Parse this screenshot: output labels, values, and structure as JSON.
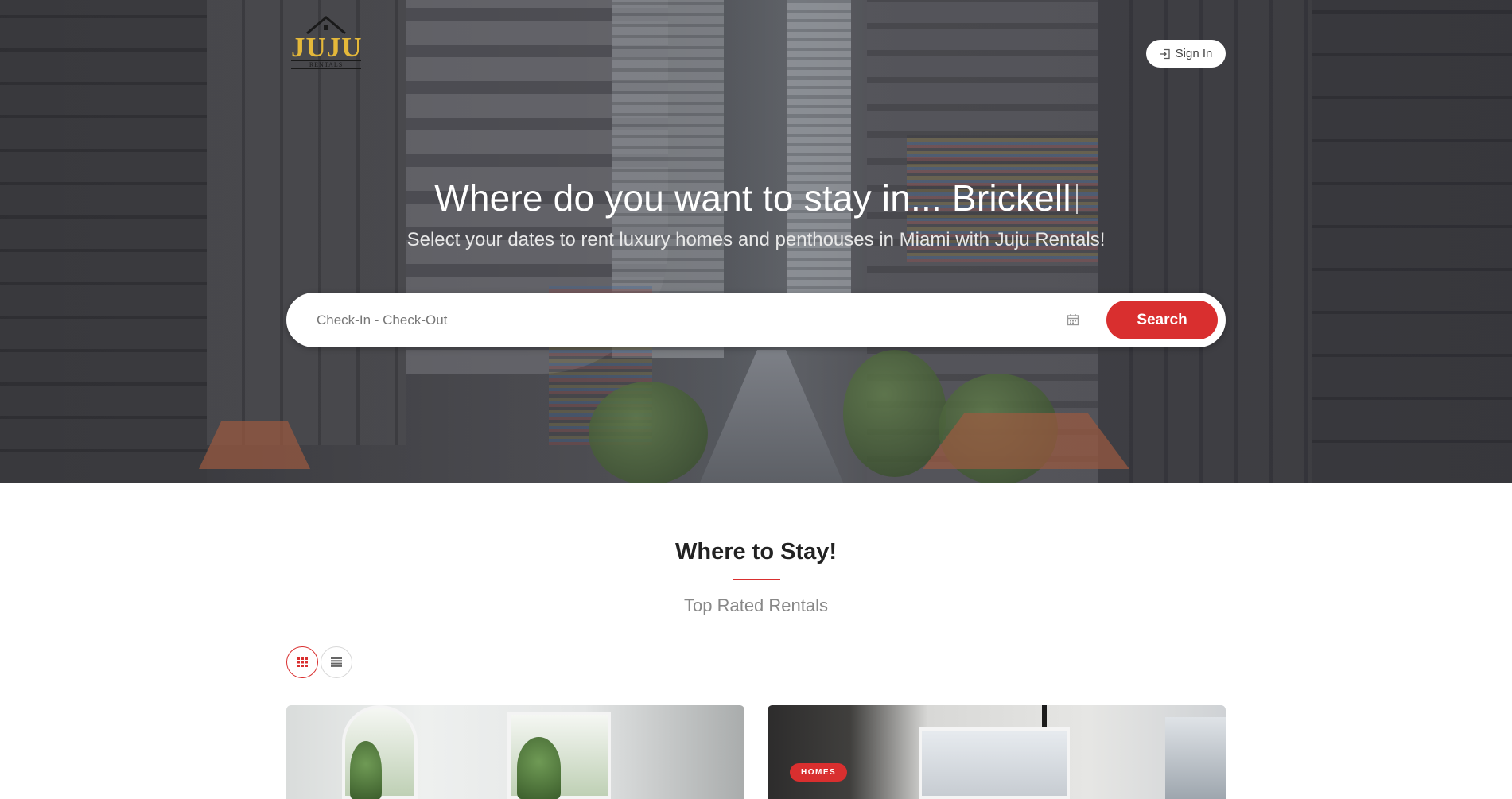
{
  "brand": {
    "name": "JUJU",
    "sub": "RENTALS",
    "gold": "#e4b83a"
  },
  "header": {
    "signin_label": "Sign In",
    "signin_icon": "sign-in-icon"
  },
  "hero": {
    "headline": "Where do you want to stay in... Brickell",
    "subline": "Select your dates to rent luxury homes and penthouses in Miami with Juju Rentals!"
  },
  "search": {
    "placeholder": "Check-In - Check-Out",
    "value": "",
    "calendar_icon": "calendar-icon",
    "button_label": "Search"
  },
  "section": {
    "title": "Where to Stay!",
    "subtitle": "Top Rated Rentals"
  },
  "view_toggle": {
    "options": [
      "grid-view-icon",
      "list-view-icon"
    ],
    "selected": "grid-view-icon"
  },
  "cards": [
    {
      "badge": ""
    },
    {
      "badge": "HOMES"
    }
  ],
  "colors": {
    "accent": "#d92f2f",
    "text": "#222222",
    "muted": "#888888"
  }
}
